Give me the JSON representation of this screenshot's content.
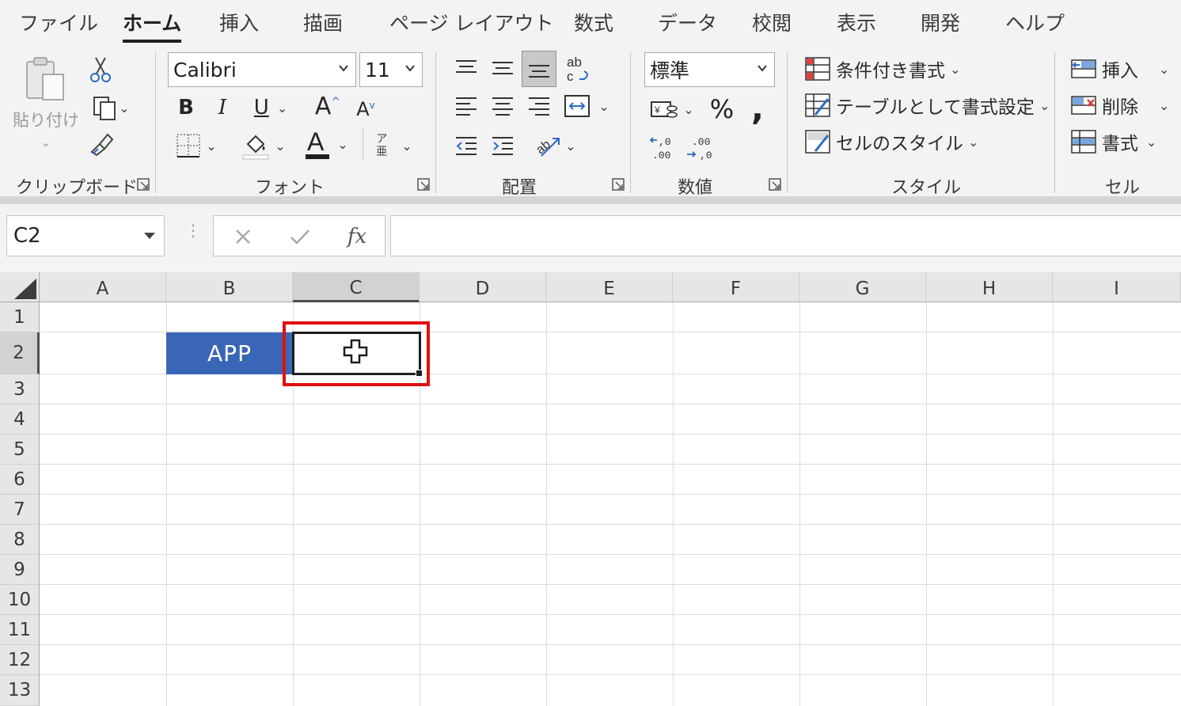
{
  "tabs": [
    "ファイル",
    "ホーム",
    "挿入",
    "描画",
    "ページ レイアウト",
    "数式",
    "データ",
    "校閲",
    "表示",
    "開発",
    "ヘルプ"
  ],
  "active_tab": "ホーム",
  "clipboard": {
    "paste_label": "貼り付け",
    "group_label": "クリップボード"
  },
  "font": {
    "name": "Calibri",
    "size": "11",
    "group_label": "フォント",
    "phonetic_top": "ア",
    "phonetic_bottom": "亜",
    "font_color": "#c00000"
  },
  "alignment": {
    "group_label": "配置"
  },
  "number": {
    "format": "標準",
    "percent": "%",
    "comma": ",",
    "group_label": "数値"
  },
  "styles": {
    "conditional_formatting": "条件付き書式",
    "format_as_table": "テーブルとして書式設定",
    "cell_styles": "セルのスタイル",
    "group_label": "スタイル"
  },
  "cells": {
    "insert": "挿入",
    "delete": "削除",
    "format": "書式",
    "group_label": "セル"
  },
  "formula_bar": {
    "name_box": "C2",
    "fx": "fx",
    "content": ""
  },
  "sheet": {
    "columns": [
      "A",
      "B",
      "C",
      "D",
      "E",
      "F",
      "G",
      "H",
      "I"
    ],
    "rows": [
      "1",
      "2",
      "3",
      "4",
      "5",
      "6",
      "7",
      "8",
      "9",
      "10",
      "11",
      "12",
      "13"
    ],
    "selected_cell": "C2",
    "cell_b2": "APP",
    "cell_b2_fill": "#3a66b8",
    "highlight_color": "#e01010"
  }
}
